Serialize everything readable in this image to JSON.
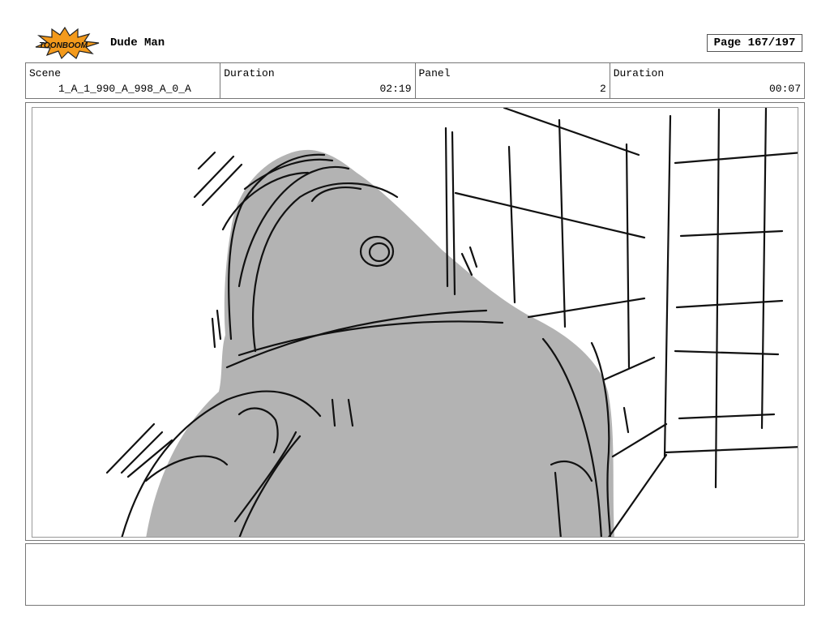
{
  "header": {
    "logo_name": "toonboom-logo",
    "logo_text": "TOONBOOM",
    "project_title": "Dude Man",
    "page_label": "Page 167/197"
  },
  "info": {
    "scene_label": "Scene",
    "scene_value": "1_A_1_990_A_998_A_0_A",
    "duration_label": "Duration",
    "duration_value": "02:19",
    "panel_label": "Panel",
    "panel_value": "2",
    "panel_duration_label": "Duration",
    "panel_duration_value": "00:07"
  },
  "colors": {
    "figure_fill": "#b3b3b3",
    "ink": "#111111",
    "logo_orange": "#f39a1c"
  },
  "notes": {
    "text": ""
  }
}
